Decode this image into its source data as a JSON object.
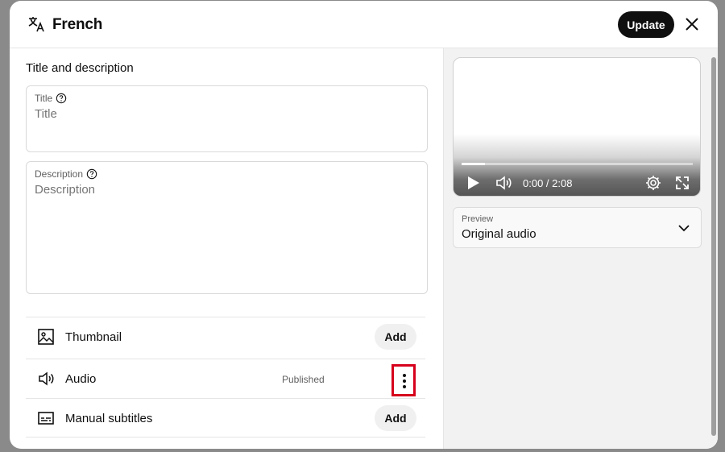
{
  "dialog": {
    "language": "French",
    "update_label": "Update"
  },
  "details": {
    "section_title": "Title and description",
    "title_field": {
      "label": "Title",
      "placeholder": "Title",
      "value": ""
    },
    "description_field": {
      "label": "Description",
      "placeholder": "Description",
      "value": ""
    }
  },
  "assets": [
    {
      "label": "Thumbnail",
      "icon": "image-icon",
      "action": "Add"
    },
    {
      "label": "Audio",
      "icon": "speaker-icon",
      "status": "Published"
    },
    {
      "label": "Manual subtitles",
      "icon": "subtitles-icon",
      "action": "Add"
    }
  ],
  "player": {
    "time": "0:00 / 2:08",
    "progress": 0.1
  },
  "preview": {
    "label": "Preview",
    "value": "Original audio"
  },
  "colors": {
    "highlight": "#d6001c",
    "button_dark": "#0f0f0f"
  }
}
